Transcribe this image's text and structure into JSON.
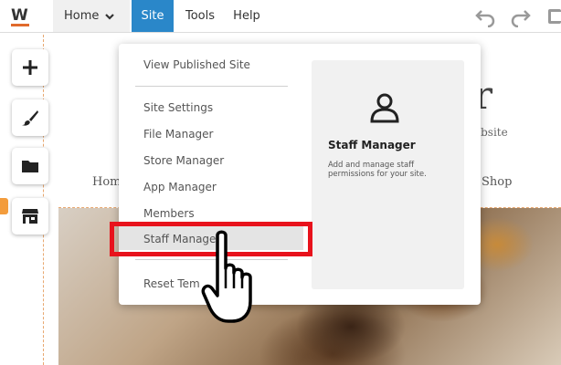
{
  "topbar": {
    "logo_letter": "W",
    "nav": {
      "home": "Home",
      "site": "Site",
      "tools": "Tools",
      "help": "Help"
    }
  },
  "rail": {
    "items": [
      {
        "name": "add-icon"
      },
      {
        "name": "brush-icon"
      },
      {
        "name": "folder-icon"
      },
      {
        "name": "store-icon"
      }
    ]
  },
  "site_preview": {
    "logo_glyph": "r",
    "tagline": "ebsite",
    "nav_home": "Hom",
    "nav_shop": "Shop"
  },
  "site_menu": {
    "items": [
      "View Published Site",
      "Site Settings",
      "File Manager",
      "Store Manager",
      "App Manager",
      "Members",
      "Staff Manager",
      "Reset Tem"
    ],
    "panel": {
      "title": "Staff Manager",
      "description": "Add and manage staff permissions for your site."
    }
  },
  "colors": {
    "site_tab": "#2a87c9",
    "highlight": "#e8121c",
    "logo": "#e06a2c"
  }
}
